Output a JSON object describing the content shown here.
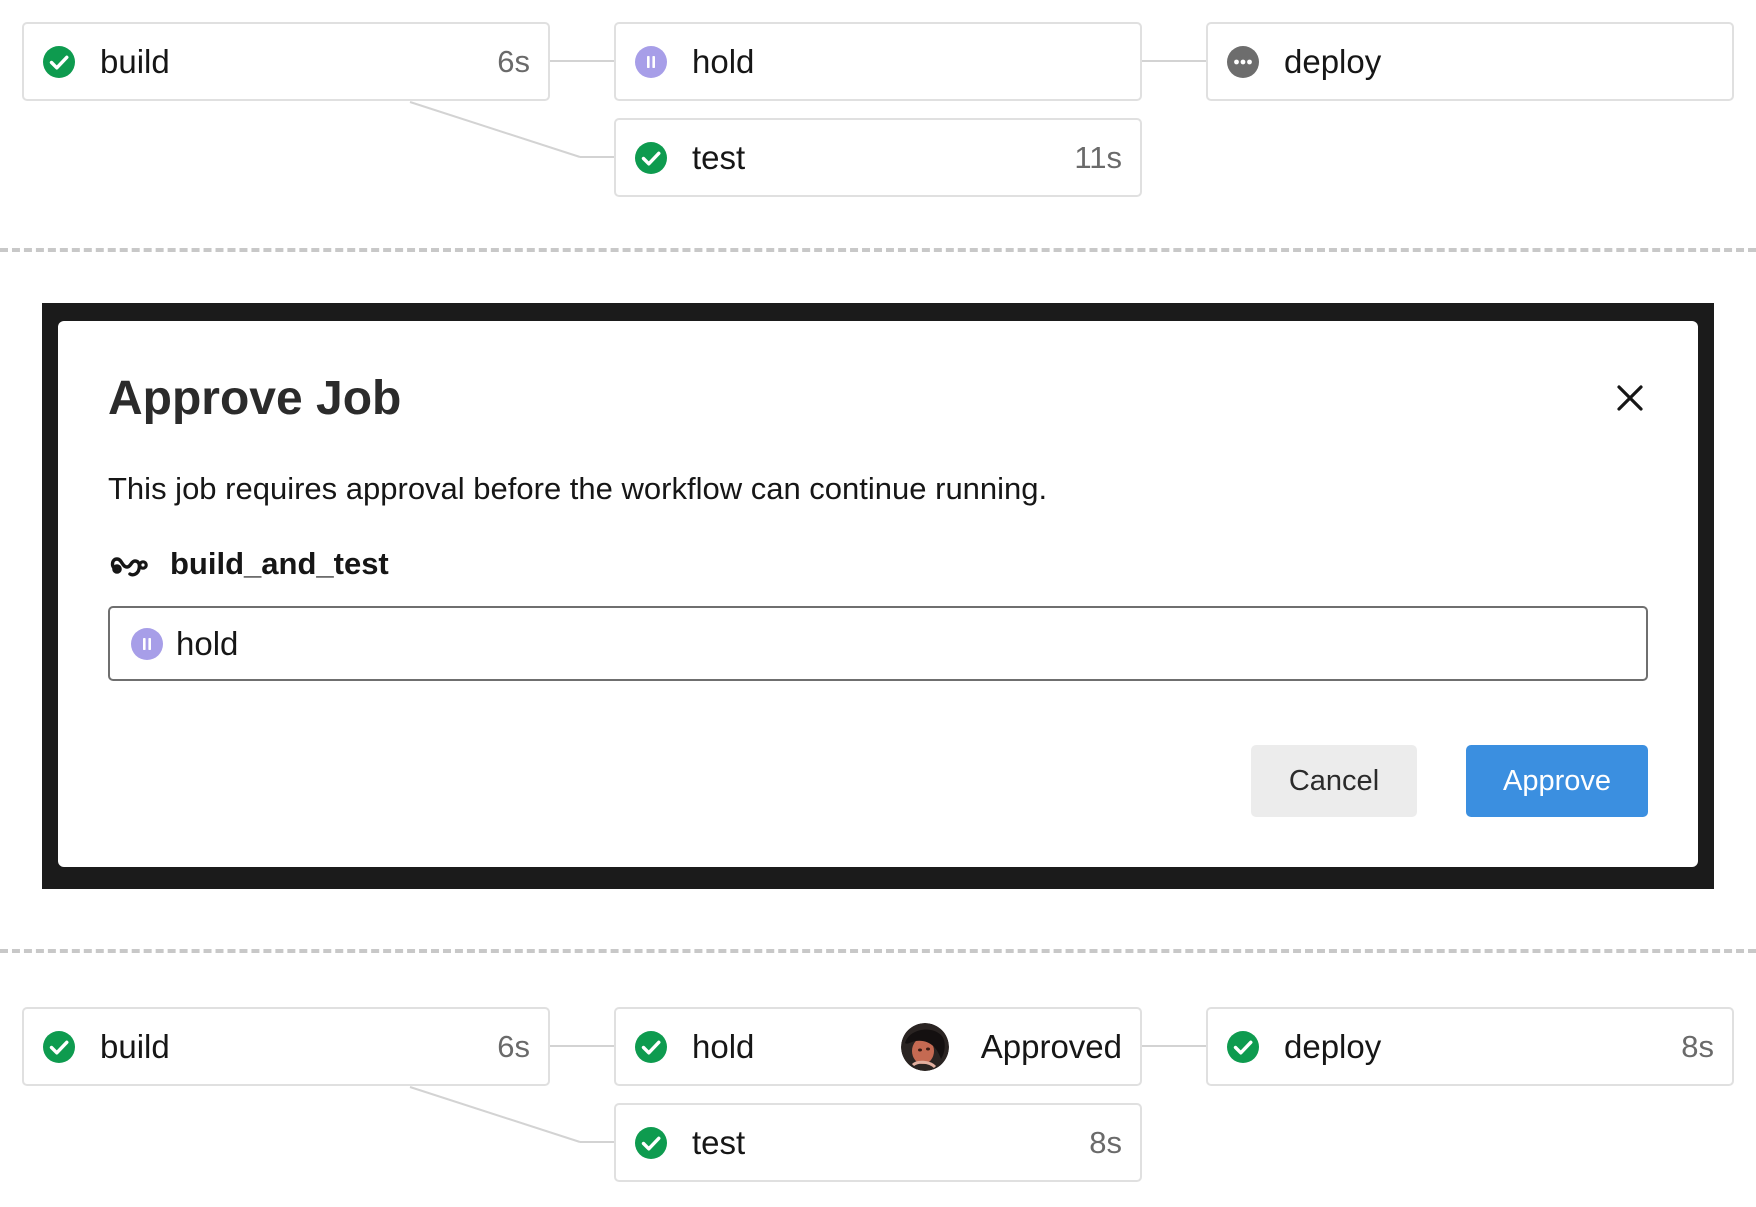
{
  "colors": {
    "success": "#0e9b4f",
    "on_hold": "#a79ee8",
    "queued": "#6d6d6d",
    "approve_button": "#3b8fe0"
  },
  "top_pipeline": {
    "build": {
      "name": "build",
      "status_icon": "check-circle-icon",
      "duration": "6s"
    },
    "hold": {
      "name": "hold",
      "status_icon": "pause-circle-icon"
    },
    "deploy": {
      "name": "deploy",
      "status_icon": "more-circle-icon"
    },
    "test": {
      "name": "test",
      "status_icon": "check-circle-icon",
      "duration": "11s"
    }
  },
  "modal": {
    "title": "Approve Job",
    "close_icon": "close-icon",
    "description": "This job requires approval before the workflow can continue running.",
    "workflow_icon": "workflow-icon",
    "workflow_name": "build_and_test",
    "job_field": {
      "status_icon": "pause-circle-icon",
      "value": "hold"
    },
    "cancel_label": "Cancel",
    "approve_label": "Approve"
  },
  "bottom_pipeline": {
    "build": {
      "name": "build",
      "status_icon": "check-circle-icon",
      "duration": "6s"
    },
    "hold": {
      "name": "hold",
      "status_icon": "check-circle-icon",
      "approver_avatar": "avatar",
      "status_text": "Approved"
    },
    "deploy": {
      "name": "deploy",
      "status_icon": "check-circle-icon",
      "duration": "8s"
    },
    "test": {
      "name": "test",
      "status_icon": "check-circle-icon",
      "duration": "8s"
    }
  }
}
